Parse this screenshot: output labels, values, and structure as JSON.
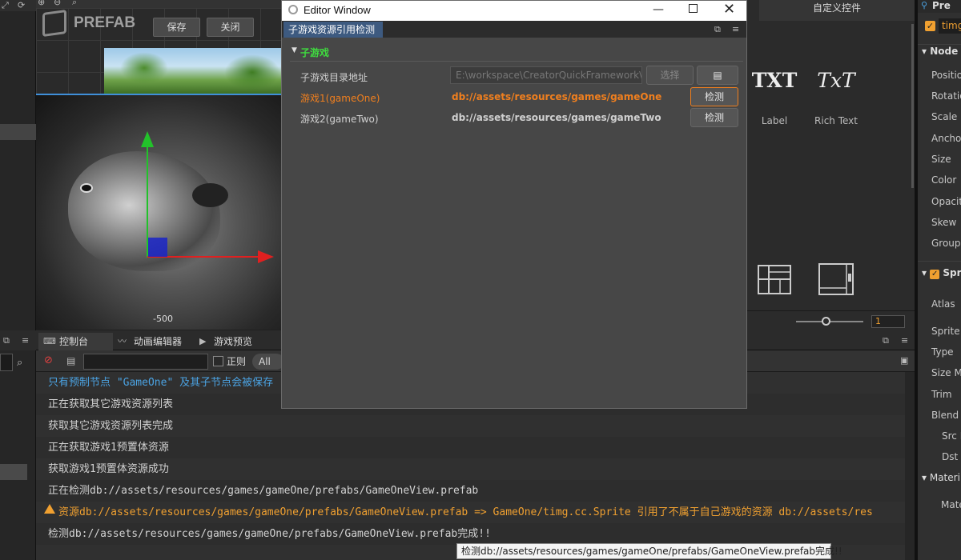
{
  "scene": {
    "prefab_label": "PREFAB",
    "save_label": "保存",
    "close_label": "关闭",
    "axis_label": "-500"
  },
  "left_column": {
    "search_icon": "search-icon"
  },
  "console": {
    "tabs": [
      {
        "label": "控制台",
        "icon": "terminal-icon"
      },
      {
        "label": "动画编辑器",
        "icon": "animation-icon"
      },
      {
        "label": "游戏预览",
        "icon": "camera-icon"
      }
    ],
    "regex_label": "正则",
    "filter_value": "All",
    "lines": [
      {
        "text": "只有预制节点 \"GameOne\" 及其子节点会被保存",
        "color": "#4ba3e3",
        "type": "info"
      },
      {
        "text": "正在获取其它游戏资源列表",
        "color": "#d2d2d2",
        "type": "log"
      },
      {
        "text": "获取其它游戏资源列表完成",
        "color": "#d2d2d2",
        "type": "log"
      },
      {
        "text": "正在获取游戏1预置体资源",
        "color": "#d2d2d2",
        "type": "log"
      },
      {
        "text": "获取游戏1预置体资源成功",
        "color": "#d2d2d2",
        "type": "log"
      },
      {
        "text": "正在检测db://assets/resources/games/gameOne/prefabs/GameOneView.prefab",
        "color": "#d2d2d2",
        "type": "log"
      },
      {
        "text": "资源db://assets/resources/games/gameOne/prefabs/GameOneView.prefab => GameOne/timg.cc.Sprite 引用了不属于自己游戏的资源 db://assets/res",
        "color": "#f0a030",
        "type": "warn"
      },
      {
        "text": "检测db://assets/resources/games/gameOne/prefabs/GameOneView.prefab完成!!",
        "color": "#d2d2d2",
        "type": "log"
      }
    ]
  },
  "assets": {
    "header": "自定义控件",
    "items": [
      {
        "glyph": "TXT",
        "label": "Label"
      },
      {
        "glyph": "TxT",
        "label": "Rich Text"
      }
    ],
    "zoom_value": "1"
  },
  "inspector": {
    "top_label": "Pre",
    "node_name": "timg",
    "node_section": "Node",
    "node_props": [
      "Position",
      "Rotation",
      "Scale",
      "Anchor",
      "Size",
      "Color",
      "Opacity",
      "Skew",
      "Group"
    ],
    "sprite_section": "Spri",
    "sprite_props": [
      "Atlas",
      "Sprite F",
      "Type",
      "Size Mo",
      "Trim",
      "Blend",
      "Src B",
      "Dst B"
    ],
    "material_section": "Materi",
    "material_prop": "Mate"
  },
  "editor_window": {
    "title": "Editor Window",
    "tab_label": "子游戏资源引用检测",
    "section_label": "子游戏",
    "dir_label": "子游戏目录地址",
    "dir_value": "E:\\workspace\\CreatorQuickFramework\\assets",
    "select_label": "选择",
    "games": [
      {
        "label": "游戏1(gameOne)",
        "path": "db://assets/resources/games/gameOne",
        "button": "检测",
        "color": "#f07f1e"
      },
      {
        "label": "游戏2(gameTwo)",
        "path": "db://assets/resources/games/gameTwo",
        "button": "检测",
        "color": "#d0d0d0"
      }
    ]
  },
  "tooltip": "检测db://assets/resources/games/gameOne/prefabs/GameOneView.prefab完成!!"
}
